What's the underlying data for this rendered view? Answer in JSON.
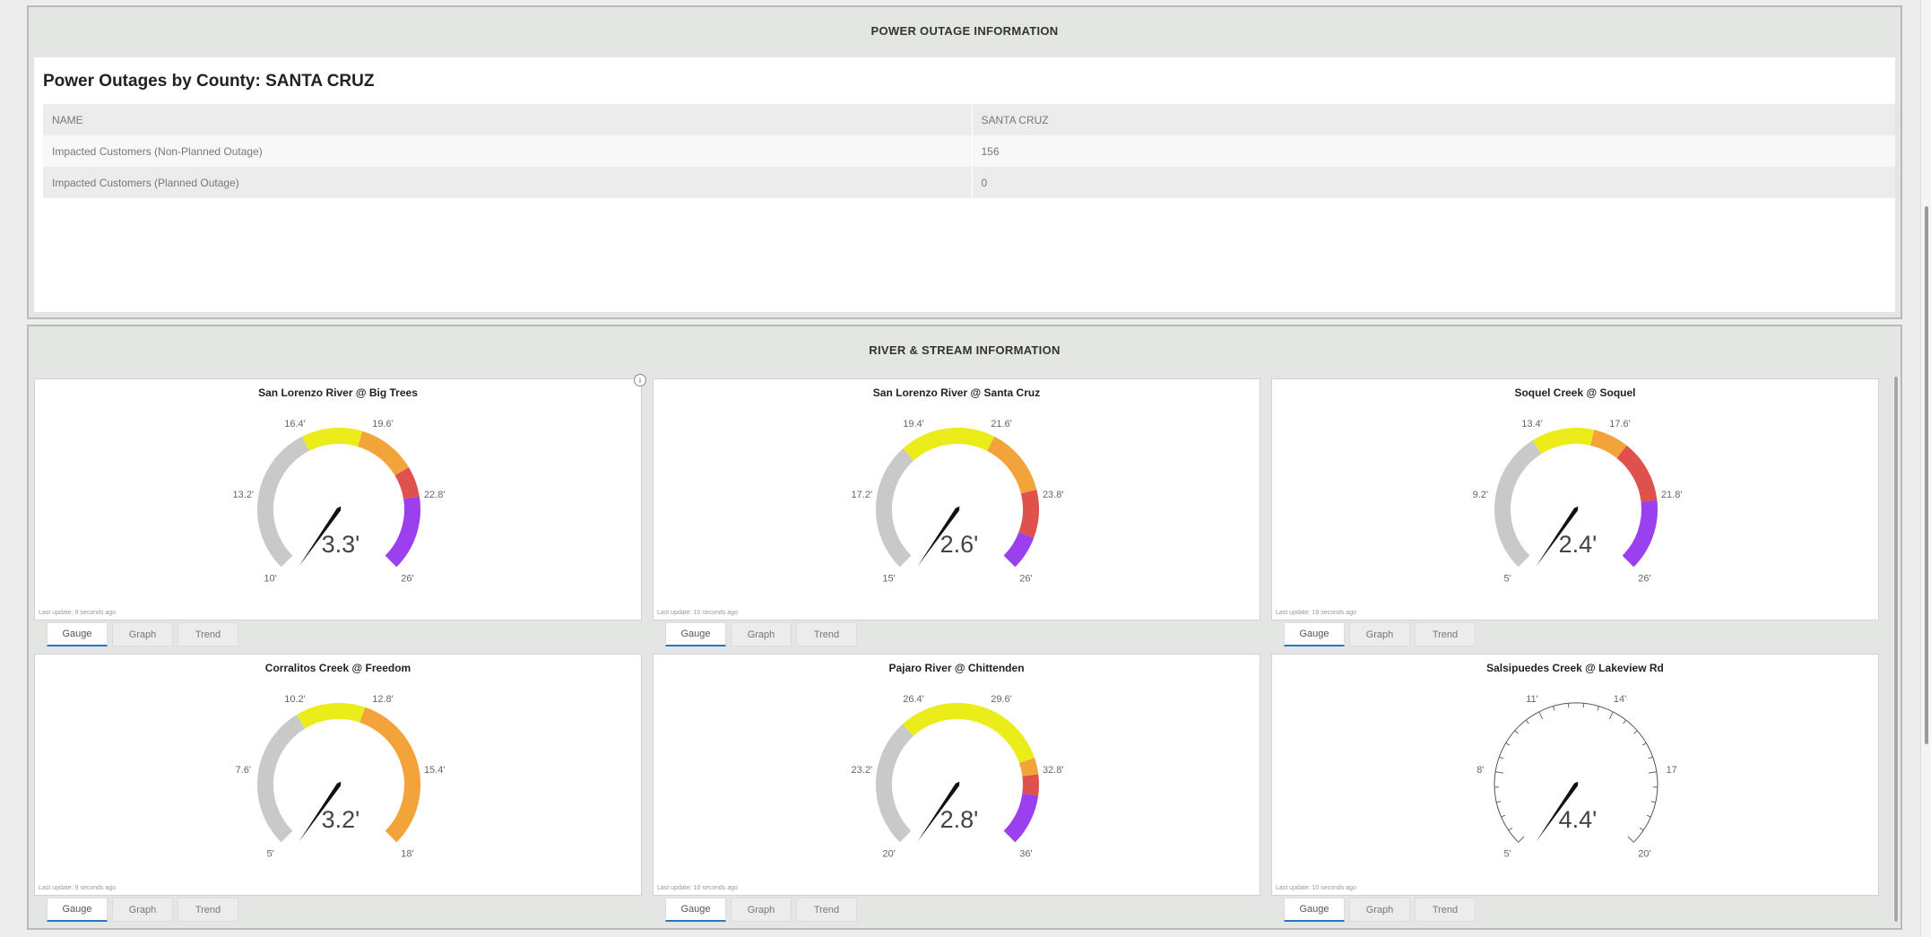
{
  "outage": {
    "header": "POWER OUTAGE INFORMATION",
    "title": "Power Outages by County: SANTA CRUZ",
    "rows": [
      {
        "label": "NAME",
        "value": "SANTA CRUZ"
      },
      {
        "label": "Impacted Customers (Non-Planned Outage)",
        "value": "156"
      },
      {
        "label": "Impacted Customers (Planned Outage)",
        "value": "0"
      }
    ]
  },
  "river": {
    "header": "RIVER & STREAM INFORMATION",
    "tabs": [
      "Gauge",
      "Graph",
      "Trend"
    ],
    "gauges": [
      {
        "title": "San Lorenzo River @ Big Trees",
        "value_label": "3.3'",
        "value": 3.3,
        "min": 10,
        "max": 26,
        "tick_labels": [
          {
            "v": 10,
            "t": "10'"
          },
          {
            "v": 13.2,
            "t": "13.2'"
          },
          {
            "v": 16.4,
            "t": "16.4'"
          },
          {
            "v": 19.6,
            "t": "19.6'"
          },
          {
            "v": 22.8,
            "t": "22.8'"
          },
          {
            "v": 26,
            "t": "26'"
          }
        ],
        "bands": [
          {
            "from": 10,
            "to": 16.4,
            "color": "#c9c9c9"
          },
          {
            "from": 16.4,
            "to": 19.0,
            "color": "#ecec1a"
          },
          {
            "from": 19.0,
            "to": 21.5,
            "color": "#f2a33a"
          },
          {
            "from": 21.5,
            "to": 22.8,
            "color": "#e0504c"
          },
          {
            "from": 22.8,
            "to": 26,
            "color": "#9b40ee"
          }
        ],
        "last_update": "Last update: 9 seconds ago",
        "active_tab": 0
      },
      {
        "title": "San Lorenzo River @ Santa Cruz",
        "value_label": "2.6'",
        "value": 2.6,
        "min": 15,
        "max": 26,
        "tick_labels": [
          {
            "v": 15,
            "t": "15'"
          },
          {
            "v": 17.2,
            "t": "17.2'"
          },
          {
            "v": 19.4,
            "t": "19.4'"
          },
          {
            "v": 21.6,
            "t": "21.6'"
          },
          {
            "v": 23.8,
            "t": "23.8'"
          },
          {
            "v": 26,
            "t": "26'"
          }
        ],
        "bands": [
          {
            "from": 15,
            "to": 18.8,
            "color": "#c9c9c9"
          },
          {
            "from": 18.8,
            "to": 21.6,
            "color": "#ecec1a"
          },
          {
            "from": 21.6,
            "to": 23.6,
            "color": "#f2a33a"
          },
          {
            "from": 23.6,
            "to": 25.0,
            "color": "#e0504c"
          },
          {
            "from": 25.0,
            "to": 26,
            "color": "#9b40ee"
          }
        ],
        "last_update": "Last update: 10 seconds ago",
        "active_tab": 0
      },
      {
        "title": "Soquel Creek @ Soquel",
        "value_label": "2.4'",
        "value": 2.4,
        "min": 5,
        "max": 26,
        "tick_labels": [
          {
            "v": 5,
            "t": "5'"
          },
          {
            "v": 9.2,
            "t": "9.2'"
          },
          {
            "v": 13.4,
            "t": "13.4'"
          },
          {
            "v": 17.6,
            "t": "17.6'"
          },
          {
            "v": 21.8,
            "t": "21.8'"
          },
          {
            "v": 26,
            "t": "26'"
          }
        ],
        "bands": [
          {
            "from": 5,
            "to": 13.0,
            "color": "#c9c9c9"
          },
          {
            "from": 13.0,
            "to": 16.5,
            "color": "#ecec1a"
          },
          {
            "from": 16.5,
            "to": 18.5,
            "color": "#f2a33a"
          },
          {
            "from": 18.5,
            "to": 22.0,
            "color": "#e0504c"
          },
          {
            "from": 22.0,
            "to": 26,
            "color": "#9b40ee"
          }
        ],
        "last_update": "Last update: 18 seconds ago",
        "active_tab": 0
      },
      {
        "title": "Corralitos Creek @ Freedom",
        "value_label": "3.2'",
        "value": 3.2,
        "min": 5,
        "max": 18,
        "tick_labels": [
          {
            "v": 5,
            "t": "5'"
          },
          {
            "v": 7.6,
            "t": "7.6'"
          },
          {
            "v": 10.2,
            "t": "10.2'"
          },
          {
            "v": 12.8,
            "t": "12.8'"
          },
          {
            "v": 15.4,
            "t": "15.4'"
          },
          {
            "v": 18,
            "t": "18'"
          }
        ],
        "bands": [
          {
            "from": 5,
            "to": 10.0,
            "color": "#c9c9c9"
          },
          {
            "from": 10.0,
            "to": 12.4,
            "color": "#ecec1a"
          },
          {
            "from": 12.4,
            "to": 18,
            "color": "#f2a33a"
          }
        ],
        "last_update": "Last update: 9 seconds ago",
        "active_tab": 0
      },
      {
        "title": "Pajaro River @ Chittenden",
        "value_label": "2.8'",
        "value": 2.8,
        "min": 20,
        "max": 36,
        "tick_labels": [
          {
            "v": 20,
            "t": "20'"
          },
          {
            "v": 23.2,
            "t": "23.2'"
          },
          {
            "v": 26.4,
            "t": "26.4'"
          },
          {
            "v": 29.6,
            "t": "29.6'"
          },
          {
            "v": 32.8,
            "t": "32.8'"
          },
          {
            "v": 36,
            "t": "36'"
          }
        ],
        "bands": [
          {
            "from": 20,
            "to": 25.5,
            "color": "#c9c9c9"
          },
          {
            "from": 25.5,
            "to": 32.2,
            "color": "#ecec1a"
          },
          {
            "from": 32.2,
            "to": 32.9,
            "color": "#f2a33a"
          },
          {
            "from": 32.9,
            "to": 33.8,
            "color": "#e0504c"
          },
          {
            "from": 33.8,
            "to": 36,
            "color": "#9b40ee"
          }
        ],
        "last_update": "Last update: 10 seconds ago",
        "active_tab": 0
      },
      {
        "title": "Salsipuedes Creek @ Lakeview Rd",
        "value_label": "4.4'",
        "value": 4.4,
        "min": 5,
        "max": 20,
        "tick_labels": [
          {
            "v": 5,
            "t": "5'"
          },
          {
            "v": 8,
            "t": "8'"
          },
          {
            "v": 11,
            "t": "11'"
          },
          {
            "v": 14,
            "t": "14'"
          },
          {
            "v": 17,
            "t": "17"
          },
          {
            "v": 20,
            "t": "20'"
          }
        ],
        "bands": [],
        "last_update": "Last update: 10 seconds ago",
        "active_tab": 0
      }
    ]
  }
}
